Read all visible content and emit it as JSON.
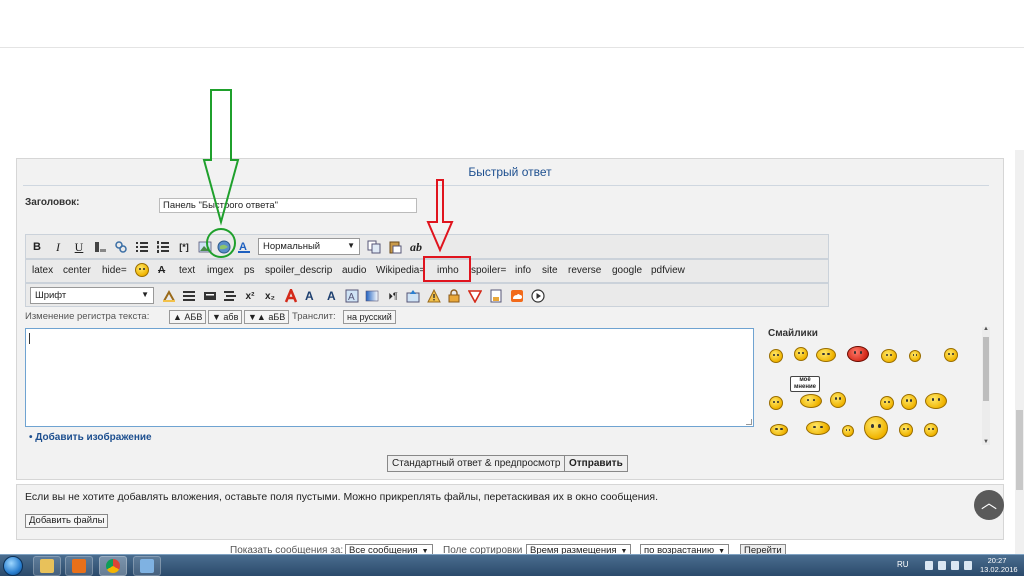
{
  "quick_reply": {
    "title": "Быстрый ответ",
    "subject_label": "Заголовок:",
    "subject_value": "Панель \"Быстрого ответа\""
  },
  "toolbar1": {
    "bold": "B",
    "italic": "I",
    "underline": "U",
    "font_size_value": "Нормальный",
    "spellcheck_label": "ab"
  },
  "toolbar2": {
    "tags": [
      "latex",
      "center",
      "hide=",
      "text",
      "imgex",
      "ps",
      "spoiler_descrip",
      "audio",
      "Wikipedia=",
      "imho",
      "spoiler=",
      "info",
      "site",
      "reverse",
      "google",
      "pdfview"
    ]
  },
  "toolbar3": {
    "font_value": "Шрифт"
  },
  "case_bar": {
    "label": "Изменение регистра текста:",
    "upper": "▲ АБВ",
    "lower": "▼ абв",
    "invert": "▼▲ аБВ",
    "translit_label": "Транслит:",
    "translit_button": "на русский"
  },
  "smilies": {
    "title": "Смайлики",
    "sign_text": "моё мнение"
  },
  "links": {
    "add_image": "• Добавить изображение"
  },
  "buttons": {
    "preview": "Стандартный ответ & предпросмотр",
    "send": "Отправить"
  },
  "attachments": {
    "note": "Если вы не хотите добавлять вложения, оставьте поля пустыми. Можно прикреплять файлы, перетаскивая их в окно сообщения.",
    "add_files": "Добавить файлы"
  },
  "sort_bar": {
    "show_label": "Показать сообщения за:",
    "show_value": "Все сообщения",
    "sort_label": "Поле сортировки",
    "sort_value": "Время размещения",
    "order_value": "по возрастанию",
    "go": "Перейти"
  },
  "taskbar": {
    "language": "RU",
    "time": "20:27",
    "date": "13.02.2016"
  },
  "colors": {
    "title_blue": "#1d4f8f",
    "annotation_green": "#1fa02c",
    "annotation_red": "#e0141e"
  },
  "scroll_top_icon": "chevron-up-icon"
}
